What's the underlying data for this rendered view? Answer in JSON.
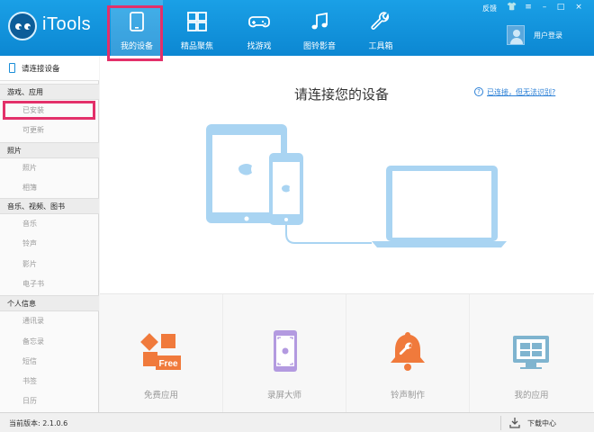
{
  "app": {
    "title": "iTools"
  },
  "topbar": {
    "feedback": "反馈",
    "login": "用户登录",
    "nav": [
      {
        "label": "我的设备"
      },
      {
        "label": "精品聚焦"
      },
      {
        "label": "找游戏"
      },
      {
        "label": "图铃影音"
      },
      {
        "label": "工具箱"
      }
    ],
    "window_controls": {
      "shirt": "👕",
      "menu": "≡",
      "minimize": "–",
      "maximize": "□",
      "close": "×"
    }
  },
  "sidebar": {
    "device": "请连接设备",
    "sections": [
      {
        "title": "游戏、应用",
        "items": [
          "已安装",
          "可更新"
        ]
      },
      {
        "title": "照片",
        "items": [
          "照片",
          "相簿"
        ]
      },
      {
        "title": "音乐、视频、图书",
        "items": [
          "音乐",
          "铃声",
          "影片",
          "电子书"
        ]
      },
      {
        "title": "个人信息",
        "items": [
          "通讯录",
          "备忘录",
          "短信",
          "书签",
          "日历"
        ]
      }
    ]
  },
  "main": {
    "headline": "请连接您的设备",
    "help_q": "?",
    "help_link": "已连接，但无法识别?",
    "tiles": [
      {
        "label": "免费应用",
        "icon_text": "Free"
      },
      {
        "label": "录屏大师"
      },
      {
        "label": "铃声制作"
      },
      {
        "label": "我的应用"
      }
    ]
  },
  "statusbar": {
    "version": "当前版本: 2.1.0.6",
    "download": "下载中心"
  },
  "colors": {
    "topbar": "#1aa0e6",
    "highlight": "#e3306a",
    "illustration": "#a9d4f2",
    "accent_orange": "#f07a3c"
  }
}
